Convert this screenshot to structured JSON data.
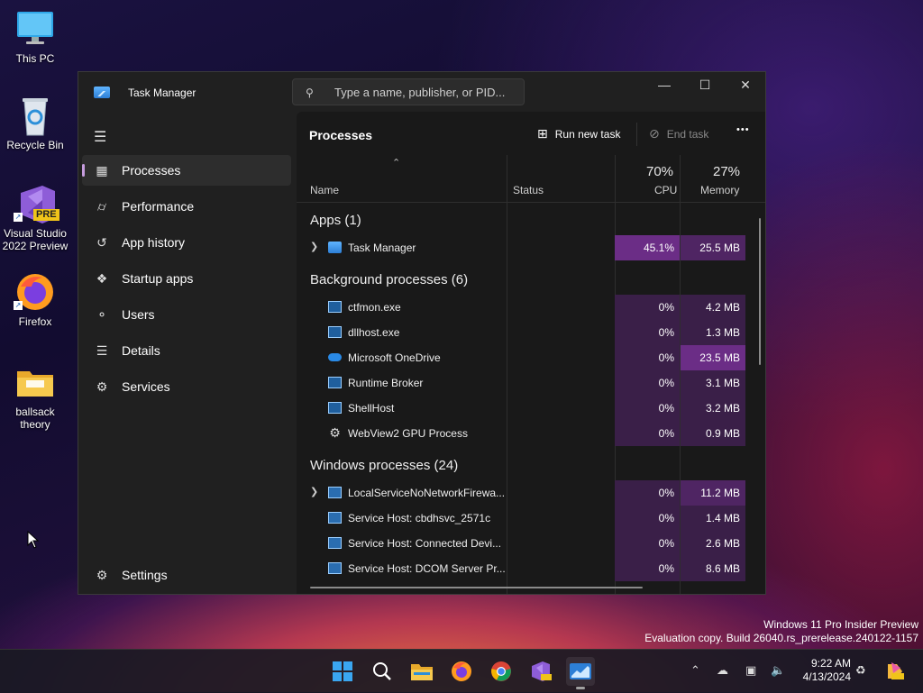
{
  "desktop": {
    "icons": [
      {
        "label": "This PC"
      },
      {
        "label": "Recycle Bin"
      },
      {
        "label": "Visual Studio 2022 Preview"
      },
      {
        "label": "Firefox"
      },
      {
        "label": "ballsack theory"
      }
    ],
    "vs_badge": "PRE"
  },
  "window": {
    "title": "Task Manager",
    "search_placeholder": "Type a name, publisher, or PID...",
    "controls": {
      "minimize": "—",
      "maximize": "☐",
      "close": "✕"
    }
  },
  "sidebar": {
    "items": [
      {
        "label": "Processes",
        "icon": "processes-icon",
        "selected": true
      },
      {
        "label": "Performance",
        "icon": "performance-icon"
      },
      {
        "label": "App history",
        "icon": "app-history-icon"
      },
      {
        "label": "Startup apps",
        "icon": "startup-apps-icon"
      },
      {
        "label": "Users",
        "icon": "users-icon"
      },
      {
        "label": "Details",
        "icon": "details-icon"
      },
      {
        "label": "Services",
        "icon": "services-icon"
      }
    ],
    "settings_label": "Settings"
  },
  "main": {
    "title": "Processes",
    "run_new_task": "Run new task",
    "end_task": "End task",
    "more": "•••",
    "columns": {
      "name": "Name",
      "status": "Status",
      "cpu_pct": "70%",
      "cpu": "CPU",
      "mem_pct": "27%",
      "memory": "Memory"
    },
    "groups": {
      "apps": "Apps (1)",
      "background": "Background processes (6)",
      "windows": "Windows processes (24)"
    },
    "rows": [
      {
        "name": "Task Manager",
        "cpu": "45.1%",
        "mem": "25.5 MB"
      },
      {
        "name": "ctfmon.exe",
        "cpu": "0%",
        "mem": "4.2 MB"
      },
      {
        "name": "dllhost.exe",
        "cpu": "0%",
        "mem": "1.3 MB"
      },
      {
        "name": "Microsoft OneDrive",
        "cpu": "0%",
        "mem": "23.5 MB"
      },
      {
        "name": "Runtime Broker",
        "cpu": "0%",
        "mem": "3.1 MB"
      },
      {
        "name": "ShellHost",
        "cpu": "0%",
        "mem": "3.2 MB"
      },
      {
        "name": "WebView2 GPU Process",
        "cpu": "0%",
        "mem": "0.9 MB"
      },
      {
        "name": "LocalServiceNoNetworkFirewa...",
        "cpu": "0%",
        "mem": "11.2 MB"
      },
      {
        "name": "Service Host: cbdhsvc_2571c",
        "cpu": "0%",
        "mem": "1.4 MB"
      },
      {
        "name": "Service Host: Connected Devi...",
        "cpu": "0%",
        "mem": "2.6 MB"
      },
      {
        "name": "Service Host: DCOM Server Pr...",
        "cpu": "0%",
        "mem": "8.6 MB"
      }
    ]
  },
  "watermark": {
    "line1": "Windows 11 Pro Insider Preview",
    "line2": "Evaluation copy. Build 26040.rs_prerelease.240122-1157"
  },
  "taskbar": {
    "time": "9:22 AM",
    "date": "4/13/2024",
    "apps": [
      "start-icon",
      "search-icon",
      "file-explorer-icon",
      "firefox-icon",
      "chrome-icon",
      "visual-studio-icon",
      "task-manager-icon"
    ]
  },
  "colors": {
    "accent": "#c69cde",
    "heat_high": "#6b2d86",
    "heat_mid": "#4f2563",
    "heat_low": "#3a1f48",
    "window_bg": "#202020",
    "panel_bg": "#191919"
  }
}
